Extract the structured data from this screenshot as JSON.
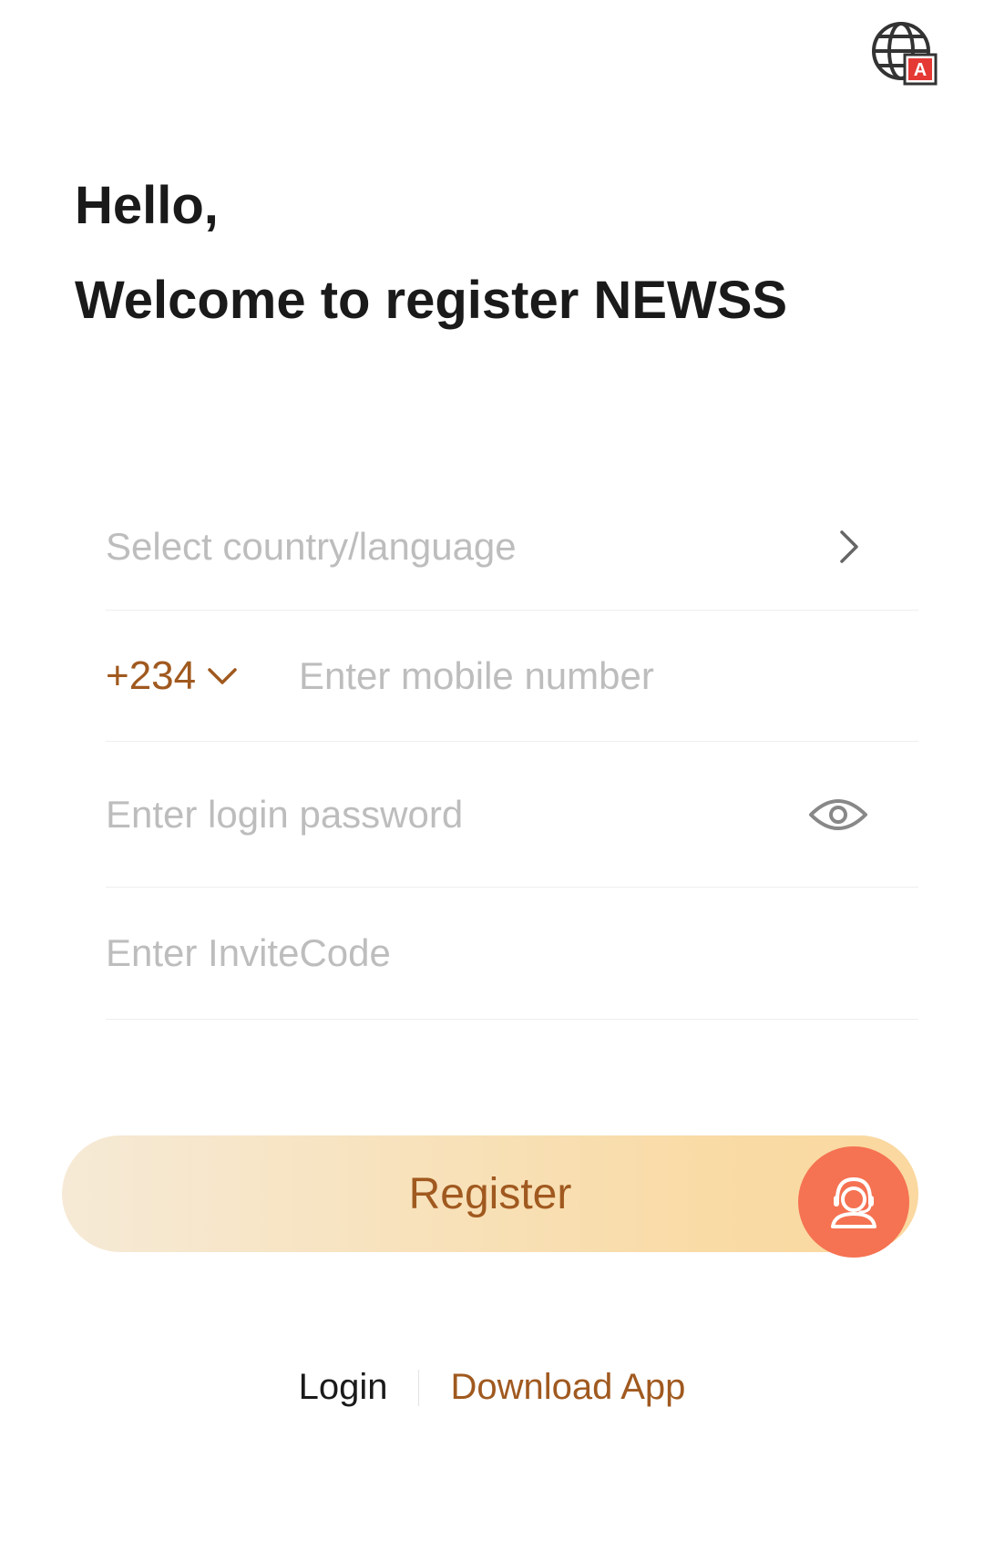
{
  "header": {
    "language_icon": "globe-language-icon"
  },
  "greeting": {
    "line1": "Hello,",
    "line2": "Welcome to register NEWSS"
  },
  "form": {
    "country_placeholder": "Select country/language",
    "country_code": "+234",
    "mobile_placeholder": "Enter mobile number",
    "password_placeholder": "Enter login password",
    "invite_placeholder": "Enter InviteCode"
  },
  "actions": {
    "register_label": "Register",
    "support_icon": "customer-service-icon"
  },
  "footer": {
    "login_label": "Login",
    "download_label": "Download App"
  },
  "colors": {
    "accent": "#a0591f",
    "support": "#f57252",
    "button_gradient_start": "#f6ead6",
    "button_gradient_end": "#fad89f",
    "placeholder": "#bdbdbd"
  }
}
